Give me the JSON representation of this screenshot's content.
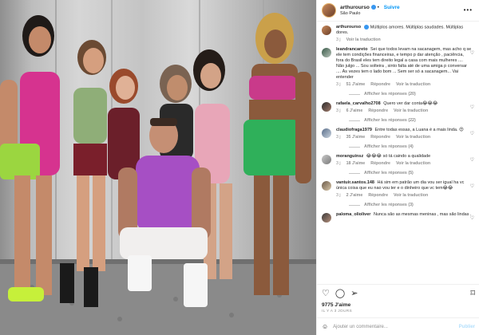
{
  "header": {
    "username": "arthurourso",
    "follow_label": "Suivre",
    "location": "São Paulo"
  },
  "caption": {
    "username": "arthurourso",
    "text": "Múltiplos amores. Múltiplas saudades. Múltiplas dores.",
    "translate": "Voir la traduction",
    "time": "3 j"
  },
  "comments": [
    {
      "username": "leandrancareto",
      "text": "Sei que todos levam na sacanagem, mas acho q se ele tem condições financeiras, e tempo p dar atenção , paciência, fora do Brasil eles tem direito legal a casa com mais mulheres .... Não julgo ... Sou solteira , sinto falta até de uma amiga p conversar .... Às vezes tem o lado bom ... Sem ser só a sacanagem... Vai entender",
      "time": "3 j",
      "likes": "51 J'aime",
      "reply": "Répondre",
      "translate": "Voir la traduction",
      "replies": "Afficher les réponses (20)"
    },
    {
      "username": "rafaela_carvalho2708",
      "text": "Quero ver dar conta😂😂😂",
      "time": "3 j",
      "likes": "6 J'aime",
      "reply": "Répondre",
      "translate": "Voir la traduction",
      "replies": "Afficher les réponses (22)"
    },
    {
      "username": "claudiofraga1979",
      "text": "Entre todas essas, a Luana é a mais linda. 😍",
      "time": "3 j",
      "likes": "35 J'aime",
      "reply": "Répondre",
      "translate": "Voir la traduction",
      "replies": "Afficher les réponses (4)"
    },
    {
      "username": "moranguinsz",
      "text": "😂😂😂 só tá caindo a qualidade",
      "time": "3 j",
      "likes": "18 J'aime",
      "reply": "Répondre",
      "translate": "Voir la traduction",
      "replies": "Afficher les réponses (5)"
    },
    {
      "username": "vantuir.santos.148",
      "text": "Há sim em patrão um dia vou ser igual ha vc única coisa que eu nao vou ter e o dinheiro que vc tem😂😂",
      "time": "3 j",
      "likes": "2 J'aime",
      "reply": "Répondre",
      "translate": "Voir la traduction",
      "replies": "Afficher les réponses (3)"
    },
    {
      "username": "paloma_olioliver",
      "text": "Nunca são as mesmas meninas , mas são lindas .",
      "time": "",
      "likes": "",
      "reply": "",
      "translate": "",
      "replies": ""
    }
  ],
  "likes": "9775 J'aime",
  "date": "IL Y A 3 JOURS",
  "add_comment": {
    "placeholder": "Ajouter un commentaire...",
    "publish_label": "Publier"
  },
  "colors": {
    "accent": "#0095f6",
    "muted": "#8e8e8e",
    "text": "#262626"
  }
}
